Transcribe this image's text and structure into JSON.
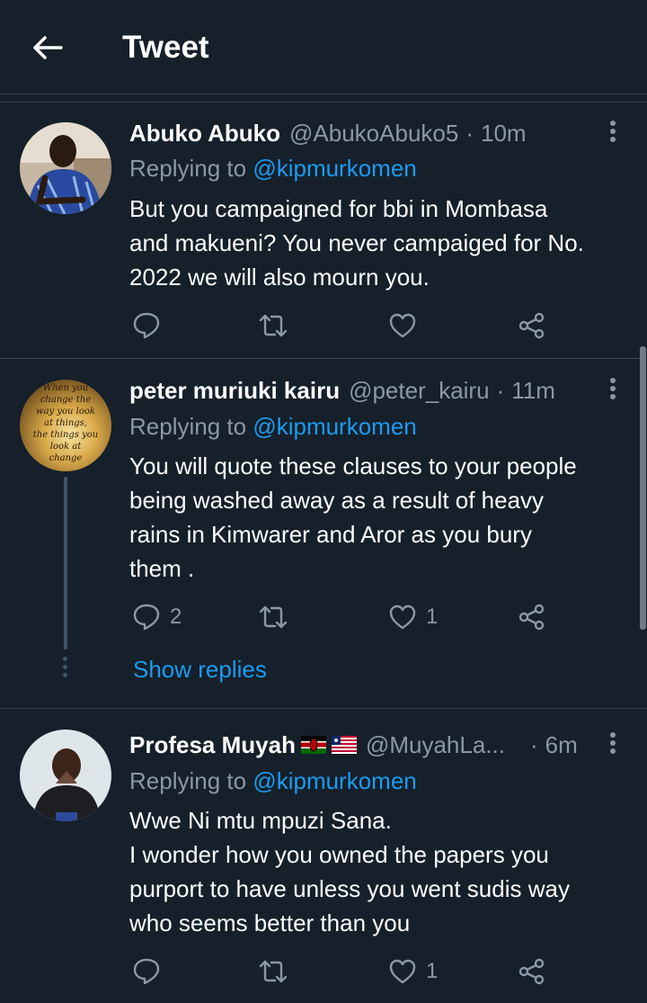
{
  "header": {
    "title": "Tweet"
  },
  "tweets": [
    {
      "name": "Abuko Abuko",
      "handle": "@AbukoAbuko5",
      "separator": "·",
      "time": "10m",
      "replying_prefix": "Replying to ",
      "replying_to": "@kipmurkomen",
      "lines": [
        "But you campaigned for bbi in Mombasa",
        "and makueni? You never campaiged for No.",
        "2022 we will also mourn you."
      ],
      "reply_count": "",
      "retweet_count": "",
      "like_count": ""
    },
    {
      "name": "peter muriuki kairu",
      "handle": "@peter_kairu",
      "separator": "·",
      "time": "11m",
      "replying_prefix": "Replying to ",
      "replying_to": "@kipmurkomen",
      "lines": [
        "You will quote these clauses to your people",
        "being washed away as a result of heavy",
        "rains in Kimwarer and Aror as you bury",
        "them ."
      ],
      "reply_count": "2",
      "retweet_count": "",
      "like_count": "1",
      "show_replies": "Show replies",
      "avatar_text": [
        "When you",
        "change the",
        "way you look",
        "at things,",
        "the things you",
        "look at",
        "change"
      ]
    },
    {
      "name": "Profesa Muyah",
      "handle": "@MuyahLa...",
      "separator": "·",
      "time": "6m",
      "replying_prefix": "Replying to ",
      "replying_to": "@kipmurkomen",
      "lines": [
        "Wwe Ni mtu mpuzi Sana.",
        "I wonder how you owned the papers you",
        "purport to have unless you went sudis way",
        "who seems better than you"
      ],
      "reply_count": "",
      "retweet_count": "",
      "like_count": "1"
    }
  ],
  "colors": {
    "background": "#15202b",
    "divider": "#38444d",
    "secondary_text": "#8b98a5",
    "accent": "#1d9bf0"
  },
  "icons": {
    "back": "arrow-left-icon",
    "more": "more-vertical-icon",
    "reply": "reply-icon",
    "retweet": "retweet-icon",
    "like": "heart-icon",
    "share": "share-icon"
  }
}
